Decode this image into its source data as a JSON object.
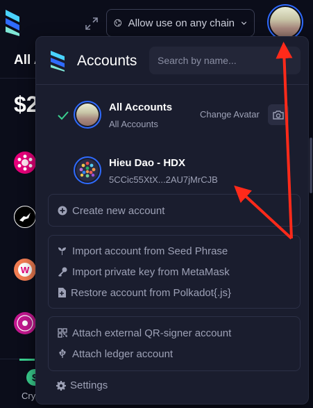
{
  "header": {
    "chain_selector_label": "Allow use on any chain"
  },
  "background": {
    "account_label": "All A",
    "balance_prefix": "$2",
    "footer_tab_label": "Cry"
  },
  "popup": {
    "title": "Accounts",
    "search_placeholder": "Search by name...",
    "accounts": [
      {
        "name": "All Accounts",
        "subtitle": "All Accounts",
        "selected": true
      },
      {
        "name": "Hieu Dao - HDX",
        "subtitle": "5CCic55XtX...2AU7jMrCJB",
        "selected": false
      }
    ],
    "change_avatar_label": "Change Avatar",
    "create_new_account": "Create new account",
    "import_actions": [
      {
        "label": "Import account from Seed Phrase",
        "icon": "seedling-icon"
      },
      {
        "label": "Import private key from MetaMask",
        "icon": "key-icon"
      },
      {
        "label": "Restore account from Polkadot{.js}",
        "icon": "file-import-icon"
      }
    ],
    "attach_actions": [
      {
        "label": "Attach external QR-signer account",
        "icon": "qrcode-icon"
      },
      {
        "label": "Attach ledger account",
        "icon": "usb-icon"
      }
    ],
    "settings_label": "Settings"
  },
  "colors": {
    "background": "#0b0d1a",
    "popup_bg": "#1a1d2e",
    "accent_blue": "#2f6bff",
    "check_green": "#3ad08f",
    "annotation_red": "#ff2a1a"
  }
}
